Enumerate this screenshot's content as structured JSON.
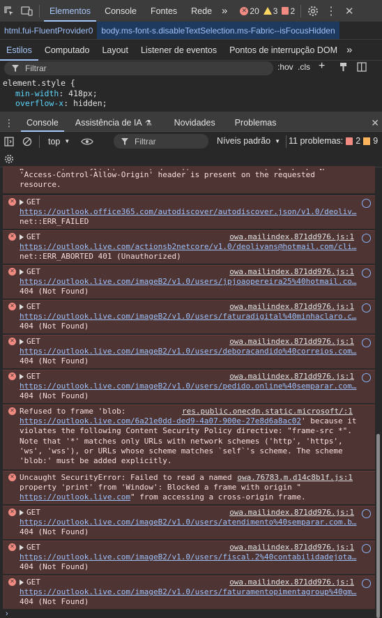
{
  "toolbar": {
    "tabs": [
      "Elementos",
      "Console",
      "Fontes",
      "Rede"
    ],
    "more": "»",
    "errors": "20",
    "warnings": "3",
    "issues": "2"
  },
  "breadcrumbs": [
    "html.fui-FluentProvider0",
    "body.ms-font-s.disableTextSelection.ms-Fabric--isFocusHidden"
  ],
  "styles": {
    "tabs": [
      "Estilos",
      "Computado",
      "Layout",
      "Listener de eventos",
      "Pontos de interrupção DOM"
    ],
    "filter_placeholder": "Filtrar",
    "hov": ":hov",
    "cls": ".cls",
    "selector": "element.style {",
    "props": [
      {
        "name": "min-width",
        "value": "418px;"
      },
      {
        "name": "overflow-x",
        "value": "hidden;"
      }
    ]
  },
  "drawer": {
    "tabs": [
      "Console",
      "Assistência de IA",
      "Novidades",
      "Problemas"
    ]
  },
  "console": {
    "context": "top",
    "filter_placeholder": "Filtrar",
    "levels": "Níveis padrão",
    "issues_label": "11 problemas:",
    "issues_err": "2",
    "issues_info": "9",
    "messages": [
      {
        "lines": [
          "Response to preflight request doesn't pass access control check: No",
          "'Access-Control-Allow-Origin' header is present on the requested",
          "resource."
        ]
      },
      {
        "get": "GET",
        "source": "",
        "url": "https://outlook.office365.com/autodiscover/autodiscover.json/v1.0/deoliv…",
        "status": "net::ERR_FAILED"
      },
      {
        "get": "GET",
        "source": "owa.mailindex.871dd976.js:1",
        "url": "https://outlook.live.com/actionsb2netcore/v1.0/deolivans@hotmail.com/cli…",
        "status": "net::ERR_ABORTED 401 (Unauthorized)"
      },
      {
        "get": "GET",
        "source": "owa.mailindex.871dd976.js:1",
        "url": "https://outlook.live.com/imageB2/v1.0/users/jpjoaopereira25%40hotmail.co…",
        "status": "404 (Not Found)"
      },
      {
        "get": "GET",
        "source": "owa.mailindex.871dd976.js:1",
        "url": "https://outlook.live.com/imageB2/v1.0/users/faturadigital%40minhaclaro.c…",
        "status": "404 (Not Found)"
      },
      {
        "get": "GET",
        "source": "owa.mailindex.871dd976.js:1",
        "url": "https://outlook.live.com/imageB2/v1.0/users/deboracandido%40correios.com…",
        "status": "404 (Not Found)"
      },
      {
        "get": "GET",
        "source": "owa.mailindex.871dd976.js:1",
        "url": "https://outlook.live.com/imageB2/v1.0/users/pedido.online%40semparar.com…",
        "status": "404 (Not Found)"
      },
      {
        "csp_prefix": "Refused to frame 'blob:",
        "source": "res.public.onecdn.static.microsoft/:1",
        "url": "https://outlook.live.com/6a21e0dd-ded9-4a07-900e-27e8d6a8ac02",
        "after_url": "' because it",
        "rest": [
          "violates the following Content Security Policy directive: \"frame-src *\".",
          "Note that '*' matches only URLs with network schemes ('http', 'https',",
          "'ws', 'wss'), or URLs whose scheme matches `self`'s scheme. The scheme",
          "'blob:' must be added explicitly."
        ]
      },
      {
        "sec_prefix": "Uncaught SecurityError: Failed to read a named",
        "source": "owa.76783.m.d14c8b1f.js:1",
        "line2": "property 'print' from 'Window': Blocked a frame with origin \"",
        "url": "https://outlook.live.com",
        "after_url": "\" from accessing a cross-origin frame."
      },
      {
        "get": "GET",
        "source": "owa.mailindex.871dd976.js:1",
        "url": "https://outlook.live.com/imageB2/v1.0/users/atendimento%40semparar.com.b…",
        "status": "404 (Not Found)"
      },
      {
        "get": "GET",
        "source": "owa.mailindex.871dd976.js:1",
        "url": "https://outlook.live.com/imageB2/v1.0/users/fiscal.2%40contabilidadejota…",
        "status": "404 (Not Found)"
      },
      {
        "get": "GET",
        "source": "owa.mailindex.871dd976.js:1",
        "url": "https://outlook.live.com/imageB2/v1.0/users/faturamentopimentagroup%40gm…",
        "status": "404 (Not Found)"
      }
    ]
  }
}
